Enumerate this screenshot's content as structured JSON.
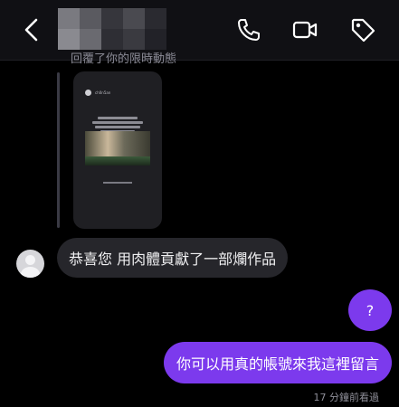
{
  "header": {
    "back_icon": "chevron-left-icon",
    "call_icon": "phone-icon",
    "video_icon": "video-camera-icon",
    "tag_icon": "tag-icon"
  },
  "thread": {
    "reply_text": "回覆了你的限時動態",
    "story": {
      "username": "ch0n5an"
    },
    "incoming_message": "恭喜您 用肉體貢獻了一部爛作品",
    "outgoing_question": "?",
    "outgoing_message": "你可以用真的帳號來我這裡留言",
    "seen_status": "17 分鐘前看過"
  },
  "colors": {
    "background": "#000000",
    "topbar": "#101014",
    "bubble_in": "#26262b",
    "bubble_out": "#7c3aed"
  }
}
